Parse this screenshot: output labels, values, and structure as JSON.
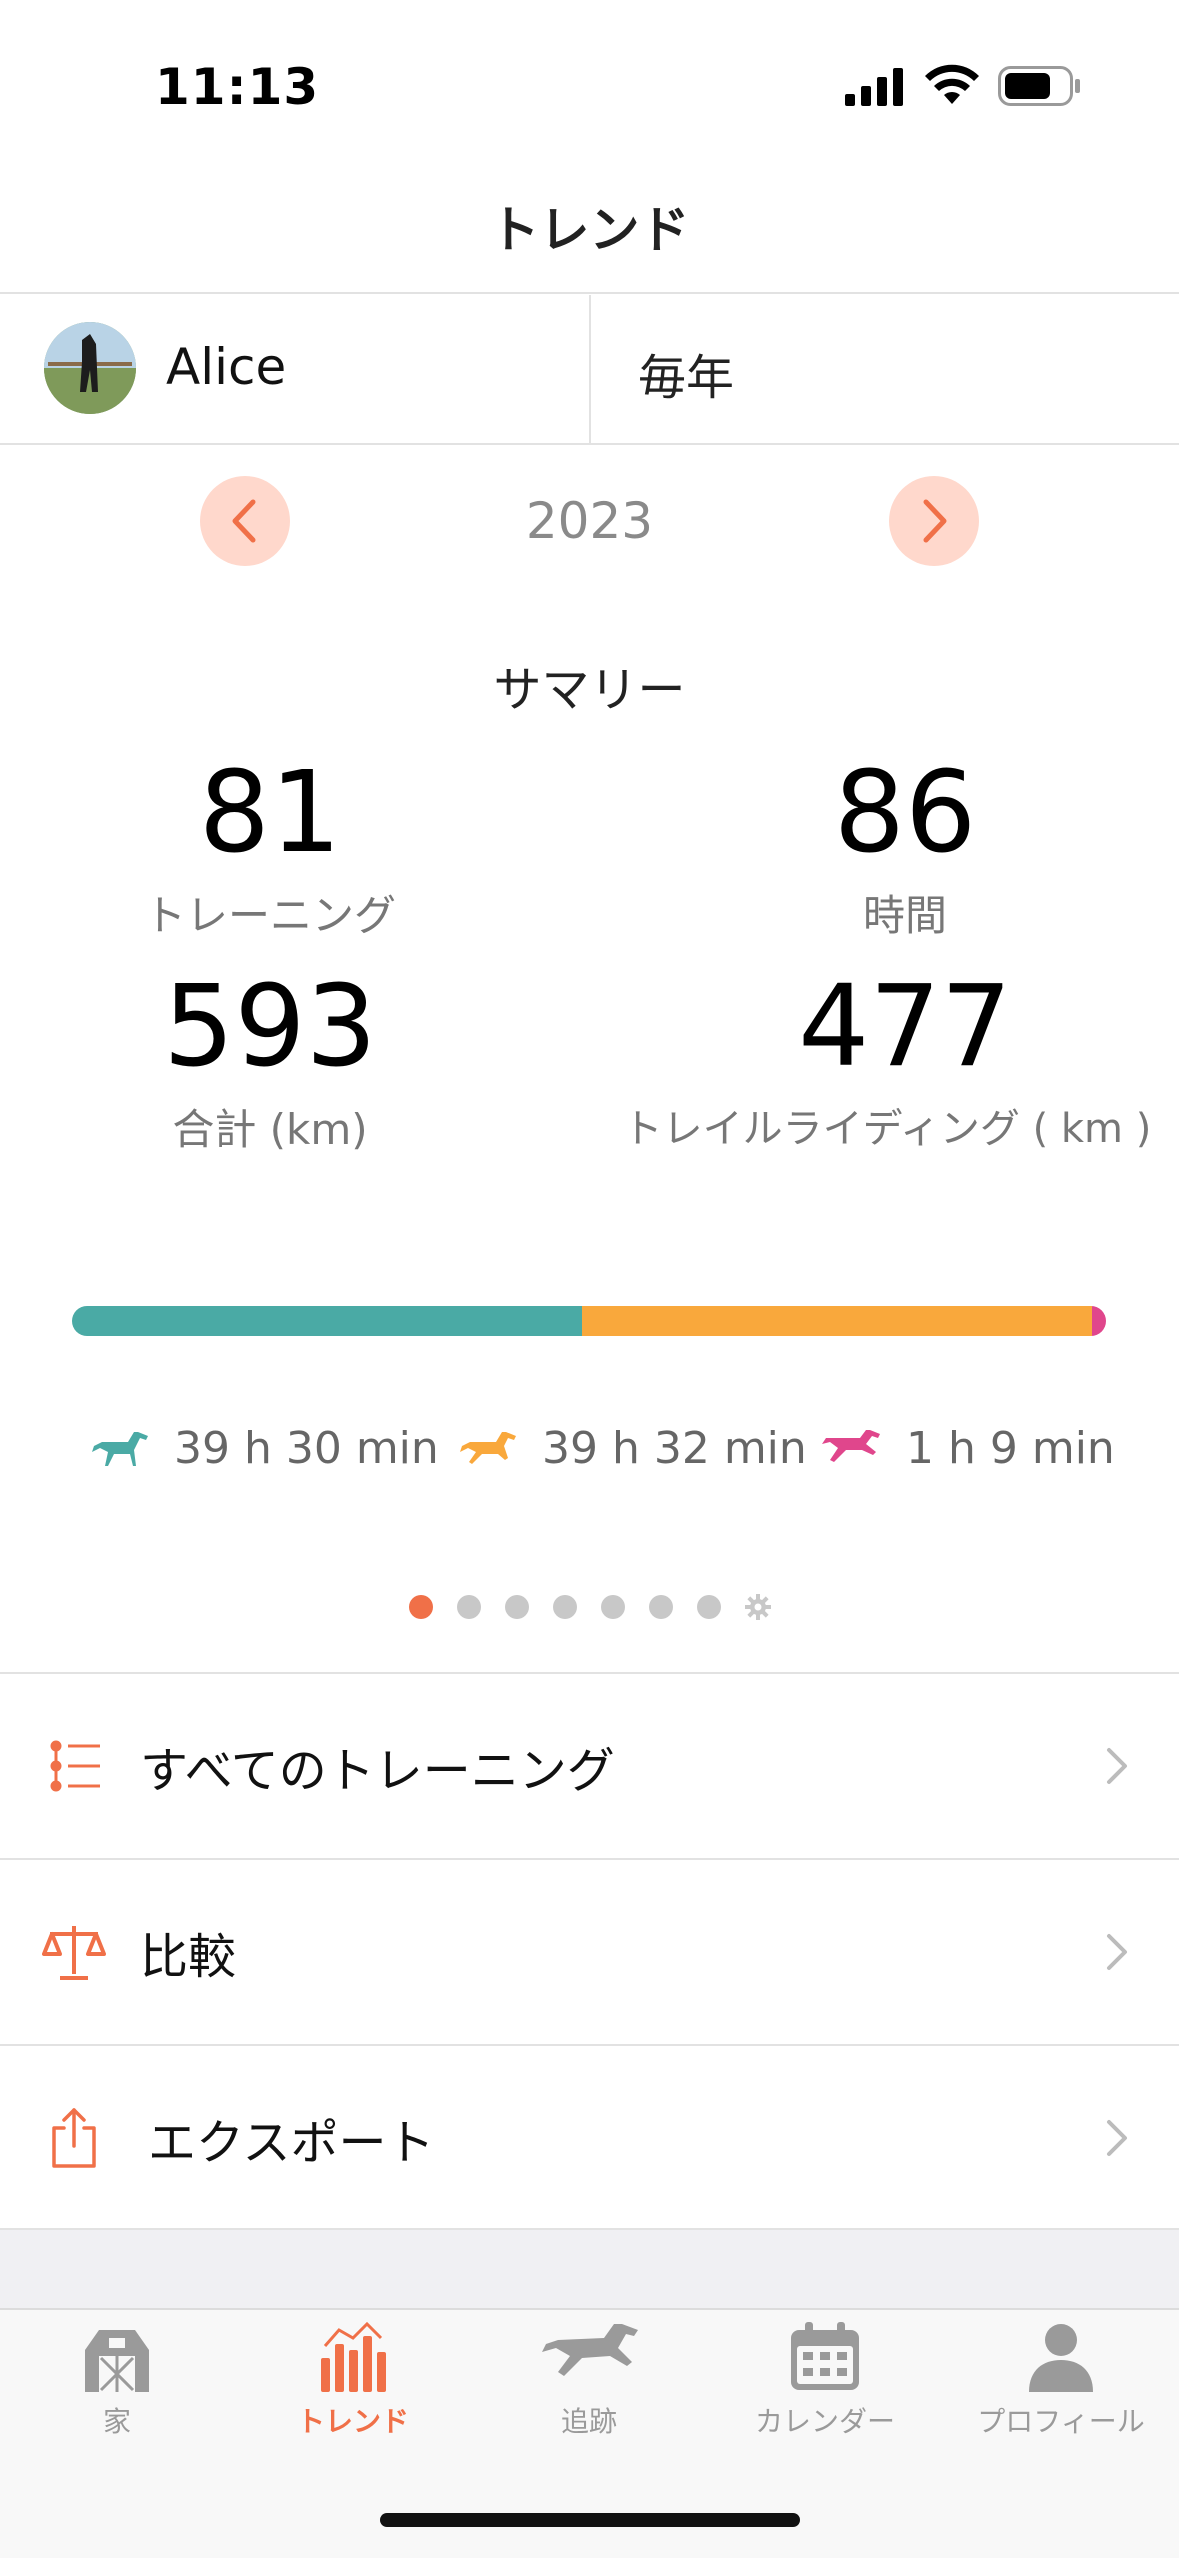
{
  "status": {
    "time": "11:13"
  },
  "header": {
    "title": "トレンド"
  },
  "profile": {
    "name": "Alice",
    "period": "毎年"
  },
  "year_nav": {
    "year": "2023"
  },
  "summary": {
    "title": "サマリー",
    "stats": [
      {
        "value": "81",
        "label": "トレーニング"
      },
      {
        "value": "86",
        "label": "時間"
      },
      {
        "value": "593",
        "label": "合計 (km)"
      },
      {
        "value": "477",
        "label": "トレイルライディング ( km )"
      }
    ]
  },
  "gait_bar": {
    "segments": [
      {
        "color": "#4aaaa5",
        "fraction": 0.493
      },
      {
        "color": "#f9a83c",
        "fraction": 0.493
      },
      {
        "color": "#e0468c",
        "fraction": 0.014
      }
    ]
  },
  "legend": [
    {
      "icon": "horse-walk-icon",
      "color": "#4aaaa5",
      "text": "39 h 30 min"
    },
    {
      "icon": "horse-trot-icon",
      "color": "#f9a83c",
      "text": "39 h 32 min"
    },
    {
      "icon": "horse-gallop-icon",
      "color": "#e0468c",
      "text": "1 h 9 min"
    }
  ],
  "pager": {
    "count": 8,
    "active_index": 0
  },
  "menu": {
    "all_trainings": "すべてのトレーニング",
    "compare": "比較",
    "export": "エクスポート"
  },
  "tabs": {
    "home": "家",
    "trends": "トレンド",
    "track": "追跡",
    "calendar": "カレンダー",
    "profile": "プロフィール"
  },
  "colors": {
    "accent": "#f07048",
    "inactive": "#9a9a9a"
  }
}
